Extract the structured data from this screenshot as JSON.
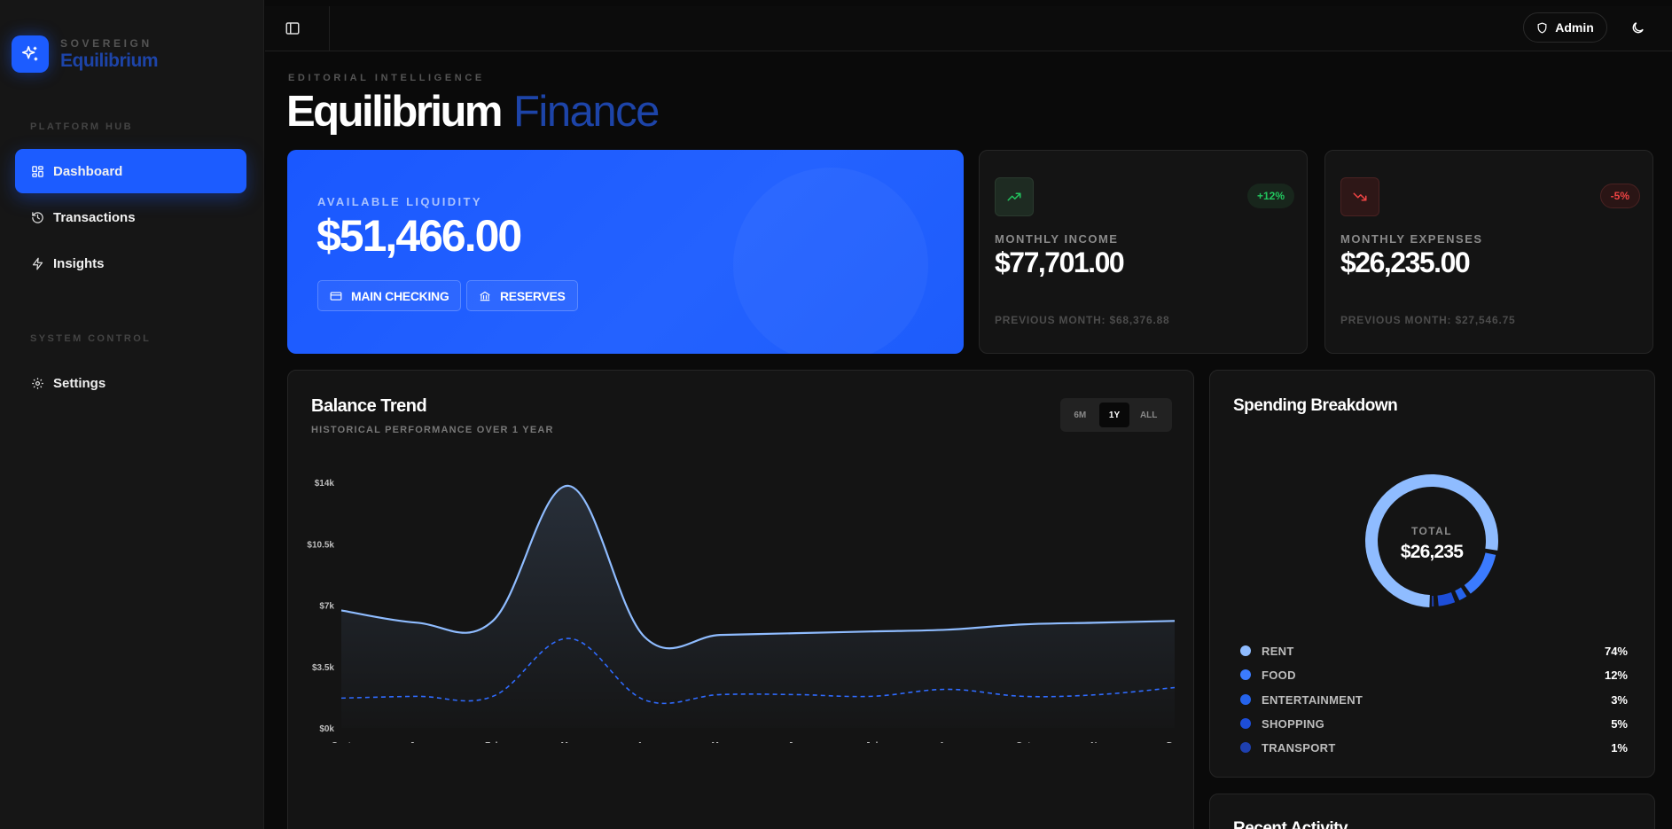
{
  "brand": {
    "sub": "SOVEREIGN",
    "name": "Equilibrium"
  },
  "sidebar": {
    "sections": [
      {
        "heading": "PLATFORM HUB"
      },
      {
        "heading": "SYSTEM CONTROL"
      }
    ],
    "items": [
      {
        "label": "Dashboard",
        "icon": "grid-icon",
        "active": true
      },
      {
        "label": "Transactions",
        "icon": "history-icon"
      },
      {
        "label": "Insights",
        "icon": "lightning-icon"
      },
      {
        "label": "Settings",
        "icon": "gear-icon"
      }
    ]
  },
  "topbar": {
    "admin_label": "Admin"
  },
  "header": {
    "eyebrow": "EDITORIAL INTELLIGENCE",
    "title": "Equilibrium",
    "title_accent": "Finance"
  },
  "liquidity": {
    "label": "AVAILABLE LIQUIDITY",
    "value": "$51,466.00",
    "accounts": [
      "MAIN CHECKING",
      "RESERVES"
    ]
  },
  "income": {
    "title": "MONTHLY INCOME",
    "value": "$77,701.00",
    "badge": "+12%",
    "previous": "PREVIOUS MONTH: $68,376.88",
    "color": "#22c55e"
  },
  "expenses": {
    "title": "MONTHLY EXPENSES",
    "value": "$26,235.00",
    "badge": "-5%",
    "previous": "PREVIOUS MONTH: $27,546.75",
    "color": "#ef4444"
  },
  "trend": {
    "title": "Balance Trend",
    "subtitle": "HISTORICAL PERFORMANCE OVER 1 YEAR",
    "ranges": [
      "6M",
      "1Y",
      "ALL"
    ],
    "active_range": "1Y"
  },
  "chart_data": {
    "type": "area",
    "categories": [
      "Sept",
      "Jan",
      "Feb",
      "Mar",
      "Apr",
      "May",
      "Jun",
      "Jul",
      "Aug",
      "Oct",
      "Nov",
      "Dec"
    ],
    "series": [
      {
        "values": [
          6700,
          6000,
          6100,
          13800,
          5200,
          5300,
          5400,
          5500,
          5600,
          5900,
          6000,
          6100
        ],
        "color": "#8fbcff",
        "style": "solid"
      },
      {
        "values": [
          1700,
          1800,
          1800,
          5100,
          1600,
          1900,
          1900,
          1800,
          2200,
          1800,
          1900,
          2300
        ],
        "color": "#2f6bff",
        "style": "dashed"
      }
    ],
    "yticks": [
      "$0k",
      "$3.5k",
      "$7k",
      "$10.5k",
      "$14k"
    ],
    "ylim": [
      0,
      14000
    ]
  },
  "spending": {
    "title": "Spending Breakdown",
    "total_label": "TOTAL",
    "total": "$26,235",
    "items": [
      {
        "name": "RENT",
        "pct": "74%",
        "value": 74,
        "color": "#8fbcff"
      },
      {
        "name": "FOOD",
        "pct": "12%",
        "value": 12,
        "color": "#3b7bff"
      },
      {
        "name": "ENTERTAINMENT",
        "pct": "3%",
        "value": 3,
        "color": "#2563eb"
      },
      {
        "name": "SHOPPING",
        "pct": "5%",
        "value": 5,
        "color": "#1d4ed8"
      },
      {
        "name": "TRANSPORT",
        "pct": "1%",
        "value": 1,
        "color": "#1e40af"
      }
    ]
  },
  "recent": {
    "title": "Recent Activity"
  }
}
